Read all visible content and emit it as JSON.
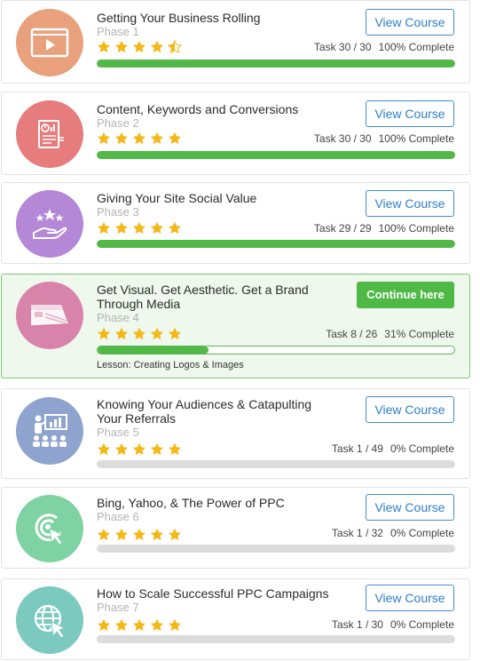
{
  "courses": [
    {
      "title": "Getting Your Business Rolling",
      "phase": "Phase 1",
      "rating": 4.5,
      "task": "Task 30 / 30",
      "complete": "100% Complete",
      "progress_pct": 100,
      "button": "View Course",
      "icon": "video-player-icon",
      "color": "#e8a07d"
    },
    {
      "title": "Content, Keywords and Conversions",
      "phase": "Phase 2",
      "rating": 5,
      "task": "Task 30 / 30",
      "complete": "100% Complete",
      "progress_pct": 100,
      "button": "View Course",
      "icon": "analytics-document-icon",
      "color": "#e77c7c"
    },
    {
      "title": "Giving Your Site Social Value",
      "phase": "Phase 3",
      "rating": 5,
      "task": "Task 29 / 29",
      "complete": "100% Complete",
      "progress_pct": 100,
      "button": "View Course",
      "icon": "hand-stars-icon",
      "color": "#b488d6"
    },
    {
      "title": "Get Visual. Get Aesthetic. Get a Brand Through Media",
      "phase": "Phase 4",
      "rating": 5,
      "task": "Task 8 / 26",
      "complete": "31% Complete",
      "progress_pct": 31,
      "button": "Continue here",
      "lesson": "Lesson: Creating Logos & Images",
      "icon": "color-swatch-icon",
      "color": "#d884aa"
    },
    {
      "title": "Knowing Your Audiences & Catapulting Your Referrals",
      "phase": "Phase 5",
      "rating": 5,
      "task": "Task 1 / 49",
      "complete": "0% Complete",
      "progress_pct": 0,
      "button": "View Course",
      "icon": "presentation-audience-icon",
      "color": "#8ea4cf"
    },
    {
      "title": "Bing, Yahoo, & The Power of PPC",
      "phase": "Phase 6",
      "rating": 5,
      "task": "Task 1 / 32",
      "complete": "0% Complete",
      "progress_pct": 0,
      "button": "View Course",
      "icon": "target-click-icon",
      "color": "#7fd2a2"
    },
    {
      "title": "How to Scale Successful PPC Campaigns",
      "phase": "Phase 7",
      "rating": 5,
      "task": "Task 1 / 30",
      "complete": "0% Complete",
      "progress_pct": 0,
      "button": "View Course",
      "icon": "globe-click-icon",
      "color": "#7cc9c0"
    }
  ],
  "colors": {
    "star": "#f5b716",
    "progress": "#52b848",
    "button_border": "#3d8fd6",
    "active_bg": "#eef8ec"
  }
}
